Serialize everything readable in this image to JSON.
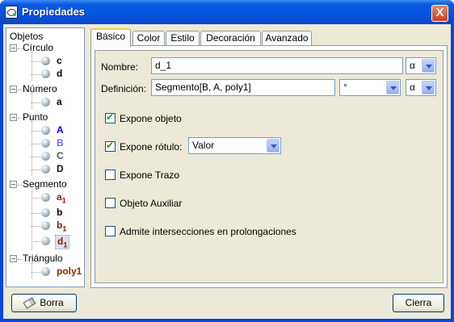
{
  "window": {
    "title": "Propiedades",
    "close_glyph": "X"
  },
  "tree": {
    "root": "Objetos",
    "groups": [
      {
        "label": "Círculo",
        "items": [
          {
            "text": "c",
            "sub": "",
            "color": "#000000"
          },
          {
            "text": "d",
            "sub": "",
            "color": "#000000"
          }
        ]
      },
      {
        "label": "Número",
        "items": [
          {
            "text": "a",
            "sub": "",
            "color": "#000000"
          }
        ]
      },
      {
        "label": "Punto",
        "items": [
          {
            "text": "A",
            "sub": "",
            "color": "#0000ff"
          },
          {
            "text": "B",
            "sub": "",
            "color": "#6a6aff"
          },
          {
            "text": "C",
            "sub": "",
            "color": "#555555"
          },
          {
            "text": "D",
            "sub": "",
            "color": "#111111"
          }
        ]
      },
      {
        "label": "Segmento",
        "items": [
          {
            "text": "a",
            "sub": "1",
            "color": "#8b1a10"
          },
          {
            "text": "b",
            "sub": "",
            "color": "#000000"
          },
          {
            "text": "b",
            "sub": "1",
            "color": "#8b1a10"
          },
          {
            "text": "d",
            "sub": "1",
            "color": "#8b1a10",
            "selected": true
          }
        ]
      },
      {
        "label": "Triángulo",
        "items": [
          {
            "text": "poly1",
            "sub": "",
            "color": "#8b2a00"
          }
        ]
      }
    ]
  },
  "tabs": [
    "Básico",
    "Color",
    "Estilo",
    "Decoración",
    "Avanzado"
  ],
  "form": {
    "nombre_label": "Nombre:",
    "nombre_value": "d_1",
    "alpha": "α",
    "definicion_label": "Definición:",
    "definicion_value": "Segmento[B, A, poly1]",
    "degree": "°",
    "checks": [
      {
        "label": "Expone objeto",
        "checked": true
      },
      {
        "label": "Expone rótulo:",
        "checked": true
      },
      {
        "label": "Expone Trazo",
        "checked": false
      },
      {
        "label": "Objeto Auxiliar",
        "checked": false
      },
      {
        "label": "Admite intersecciones en prolongaciones",
        "checked": false
      }
    ],
    "rotulo_value": "Valor"
  },
  "buttons": {
    "borra": "Borra",
    "cierra": "Cierra"
  }
}
